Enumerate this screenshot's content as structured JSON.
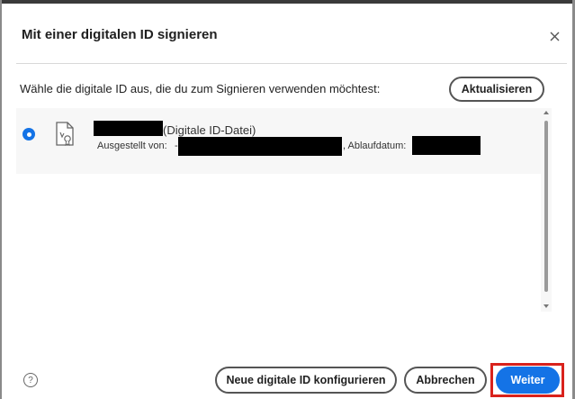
{
  "dialog": {
    "title": "Mit einer digitalen ID signieren",
    "close_icon": "close-icon"
  },
  "prompt": "Wähle die digitale ID aus, die du zum Signieren verwenden möchtest:",
  "refresh_label": "Aktualisieren",
  "id_list": {
    "items": [
      {
        "selected": true,
        "icon": "certificate-file-icon",
        "type_label": "(Digitale ID-Datei)",
        "issuer_prefix": "Ausgestellt von:",
        "issuer_dash": "-",
        "expiry_prefix": ", Ablaufdatum:"
      }
    ]
  },
  "footer": {
    "help_icon": "question-icon",
    "help_glyph": "?",
    "configure_label": "Neue digitale ID konfigurieren",
    "cancel_label": "Abbrechen",
    "next_label": "Weiter"
  },
  "colors": {
    "accent": "#1473e6",
    "highlight": "#d9221c"
  }
}
